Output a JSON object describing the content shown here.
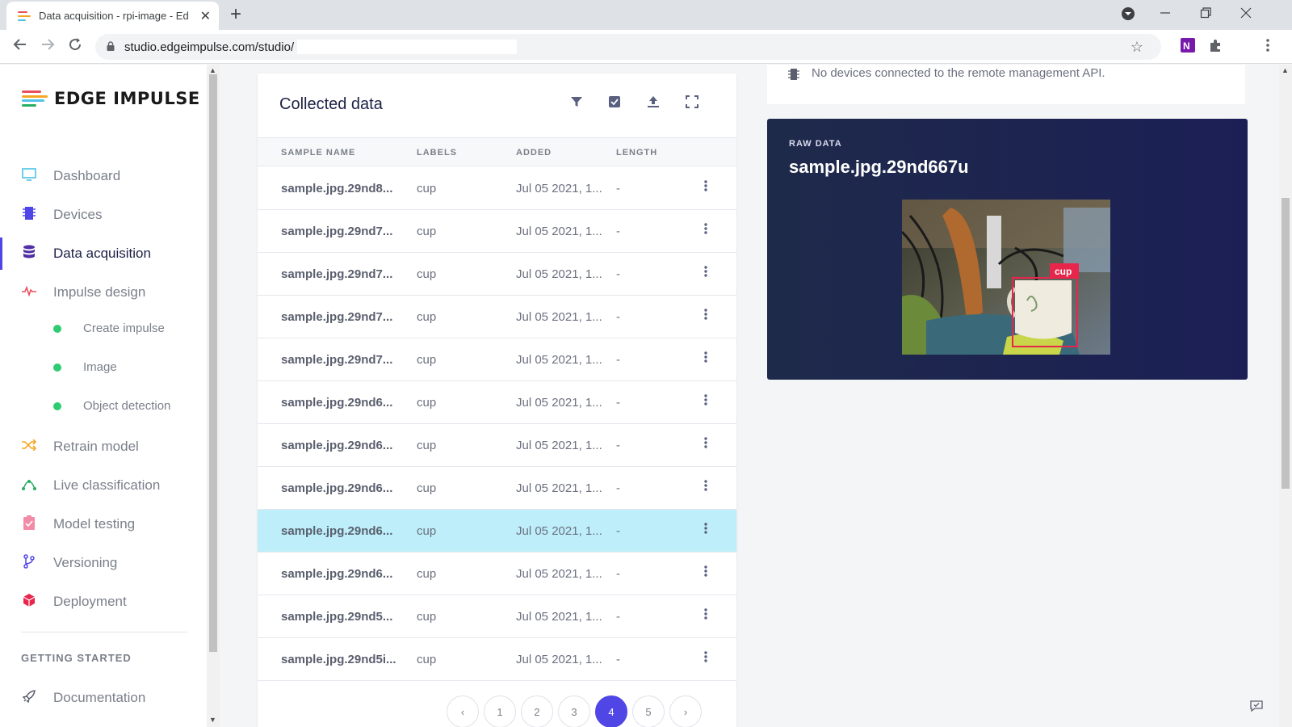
{
  "browser": {
    "tab_title": "Data acquisition - rpi-image - Ed",
    "url": "studio.edgeimpulse.com/studio/",
    "new_tab": "+",
    "close_tab": "✕"
  },
  "sidebar": {
    "logo_text": "EDGE IMPULSE",
    "items": [
      {
        "label": "Dashboard",
        "icon": "monitor-icon",
        "color": "#4ec3e6"
      },
      {
        "label": "Devices",
        "icon": "chip-icon",
        "color": "#4f46e5"
      },
      {
        "label": "Data acquisition",
        "icon": "database-icon",
        "color": "#4f2ea3"
      },
      {
        "label": "Impulse design",
        "icon": "pulse-icon",
        "color": "#e8505b"
      },
      {
        "label": "Retrain model",
        "icon": "shuffle-icon",
        "color": "#f5a623"
      },
      {
        "label": "Live classification",
        "icon": "graph-icon",
        "color": "#27ae60"
      },
      {
        "label": "Model testing",
        "icon": "clipboard-check-icon",
        "color": "#f28ba8"
      },
      {
        "label": "Versioning",
        "icon": "branch-icon",
        "color": "#4f46e5"
      },
      {
        "label": "Deployment",
        "icon": "box-icon",
        "color": "#e8254b"
      }
    ],
    "subitems": [
      "Create impulse",
      "Image",
      "Object detection"
    ],
    "section_title": "GETTING STARTED",
    "doc_item": "Documentation"
  },
  "collected": {
    "title": "Collected data",
    "columns": [
      "SAMPLE NAME",
      "LABELS",
      "ADDED",
      "LENGTH"
    ],
    "rows": [
      {
        "name": "sample.jpg.29nd8...",
        "label": "cup",
        "added": "Jul 05 2021, 1...",
        "length": "-"
      },
      {
        "name": "sample.jpg.29nd7...",
        "label": "cup",
        "added": "Jul 05 2021, 1...",
        "length": "-"
      },
      {
        "name": "sample.jpg.29nd7...",
        "label": "cup",
        "added": "Jul 05 2021, 1...",
        "length": "-"
      },
      {
        "name": "sample.jpg.29nd7...",
        "label": "cup",
        "added": "Jul 05 2021, 1...",
        "length": "-"
      },
      {
        "name": "sample.jpg.29nd7...",
        "label": "cup",
        "added": "Jul 05 2021, 1...",
        "length": "-"
      },
      {
        "name": "sample.jpg.29nd6...",
        "label": "cup",
        "added": "Jul 05 2021, 1...",
        "length": "-"
      },
      {
        "name": "sample.jpg.29nd6...",
        "label": "cup",
        "added": "Jul 05 2021, 1...",
        "length": "-"
      },
      {
        "name": "sample.jpg.29nd6...",
        "label": "cup",
        "added": "Jul 05 2021, 1...",
        "length": "-"
      },
      {
        "name": "sample.jpg.29nd6...",
        "label": "cup",
        "added": "Jul 05 2021, 1...",
        "length": "-"
      },
      {
        "name": "sample.jpg.29nd6...",
        "label": "cup",
        "added": "Jul 05 2021, 1...",
        "length": "-"
      },
      {
        "name": "sample.jpg.29nd5...",
        "label": "cup",
        "added": "Jul 05 2021, 1...",
        "length": "-"
      },
      {
        "name": "sample.jpg.29nd5i...",
        "label": "cup",
        "added": "Jul 05 2021, 1...",
        "length": "-"
      }
    ],
    "selected_row": 8,
    "pages": [
      "‹",
      "1",
      "2",
      "3",
      "4",
      "5",
      "›"
    ],
    "current_page": "4"
  },
  "devices": {
    "message": "No devices connected to the remote management API."
  },
  "raw": {
    "label": "RAW DATA",
    "title": "sample.jpg.29nd667u",
    "bbox_label": "cup"
  }
}
